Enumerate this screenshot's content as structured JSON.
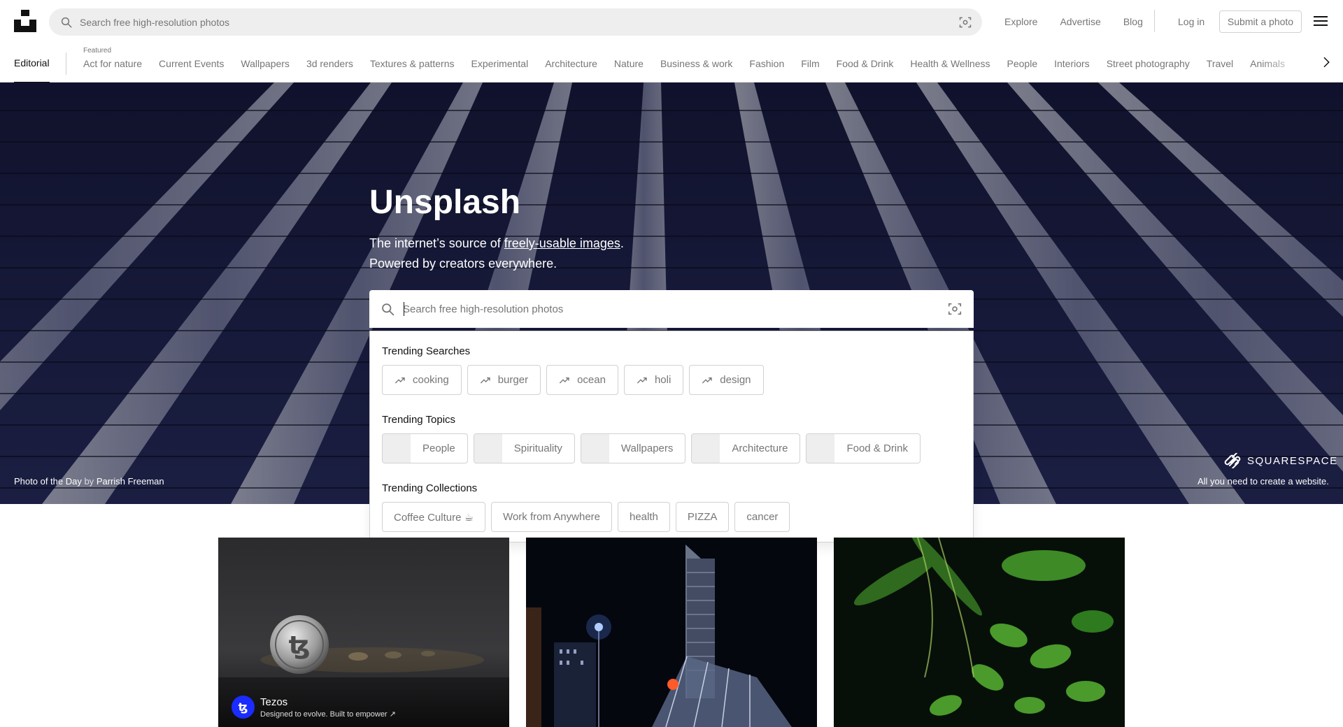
{
  "header": {
    "search_placeholder": "Search free high-resolution photos",
    "nav": [
      "Explore",
      "Advertise",
      "Blog"
    ],
    "login": "Log in",
    "submit": "Submit a photo"
  },
  "topic_nav": {
    "active": "Editorial",
    "featured_label": "Featured",
    "topics": [
      "Act for nature",
      "Current Events",
      "Wallpapers",
      "3d renders",
      "Textures & patterns",
      "Experimental",
      "Architecture",
      "Nature",
      "Business & work",
      "Fashion",
      "Film",
      "Food & Drink",
      "Health & Wellness",
      "People",
      "Interiors",
      "Street photography",
      "Travel",
      "Animals"
    ]
  },
  "hero": {
    "title": "Unsplash",
    "subtitle_prefix": "The internet’s source of ",
    "subtitle_link": "freely-usable images",
    "subtitle_suffix": ".",
    "subtitle_line2": "Powered by creators everywhere.",
    "search_placeholder": "Search free high-resolution photos",
    "photo_of_day_label": "Photo of the Day",
    "photo_of_day_by": " by ",
    "photo_of_day_author": "Parrish Freeman",
    "sponsor_brand": "SQUARESPACE",
    "sponsor_tagline": "All you need to create a website."
  },
  "dropdown": {
    "trending_searches_title": "Trending Searches",
    "trending_searches": [
      "cooking",
      "burger",
      "ocean",
      "holi",
      "design"
    ],
    "trending_topics_title": "Trending Topics",
    "trending_topics": [
      "People",
      "Spirituality",
      "Wallpapers",
      "Architecture",
      "Food & Drink"
    ],
    "trending_collections_title": "Trending Collections",
    "trending_collections": [
      "Coffee Culture ☕",
      "Work from Anywhere",
      "health",
      "PIZZA",
      "cancer"
    ]
  },
  "feed": {
    "sponsor_name": "Tezos",
    "sponsor_tagline": "Designed to evolve. Built to empower ↗",
    "sponsor_avatar": "ꜩ"
  },
  "colors": {
    "accent": "#111111",
    "muted": "#767676",
    "border": "#d1d1d1",
    "tezos_blue": "#1a2cff"
  }
}
